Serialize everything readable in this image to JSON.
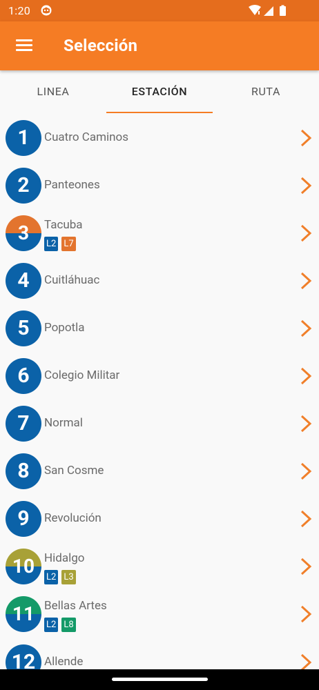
{
  "status_bar": {
    "time": "1:20",
    "icons": [
      "app-notification-icon",
      "wifi-icon",
      "signal-icon",
      "battery-icon"
    ]
  },
  "app_bar": {
    "title": "Selección",
    "menu_icon": "hamburger-menu-icon"
  },
  "tabs": [
    {
      "label": "LINEA",
      "active": false
    },
    {
      "label": "ESTACIÓN",
      "active": true
    },
    {
      "label": "RUTA",
      "active": false
    }
  ],
  "line_colors": {
    "L2": "#0b62a8",
    "L3": "#a8a137",
    "L7": "#e3742e",
    "L8": "#149a68"
  },
  "stations": [
    {
      "number": "1",
      "name": "Cuatro Caminos",
      "lines": []
    },
    {
      "number": "2",
      "name": "Panteones",
      "lines": []
    },
    {
      "number": "3",
      "name": "Tacuba",
      "lines": [
        "L2",
        "L7"
      ]
    },
    {
      "number": "4",
      "name": "Cuitláhuac",
      "lines": []
    },
    {
      "number": "5",
      "name": "Popotla",
      "lines": []
    },
    {
      "number": "6",
      "name": "Colegio Militar",
      "lines": []
    },
    {
      "number": "7",
      "name": "Normal",
      "lines": []
    },
    {
      "number": "8",
      "name": "San Cosme",
      "lines": []
    },
    {
      "number": "9",
      "name": "Revolución",
      "lines": []
    },
    {
      "number": "10",
      "name": "Hidalgo",
      "lines": [
        "L2",
        "L3"
      ]
    },
    {
      "number": "11",
      "name": "Bellas Artes",
      "lines": [
        "L2",
        "L8"
      ]
    },
    {
      "number": "12",
      "name": "Allende",
      "lines": []
    }
  ],
  "colors": {
    "primary": "#f57c24",
    "status_bar": "#e56d1d",
    "line_2": "#0b62a8",
    "chevron": "#f07f2a"
  }
}
